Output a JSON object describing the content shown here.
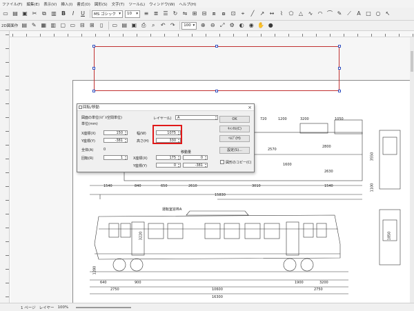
{
  "menu": [
    "ファイル(F)",
    "編集(E)",
    "表示(V)",
    "挿入(I)",
    "書式(O)",
    "図形(S)",
    "文字(T)",
    "ツール(L)",
    "ウィンドウ(W)",
    "ヘルプ(H)"
  ],
  "toolbar1": {
    "font_name": "MS ゴシック",
    "font_size": "10"
  },
  "toolbar2": {
    "label": "2D図面作",
    "zoom": "100"
  },
  "statusbar": {
    "page": "1 ページ",
    "layer": "レイヤー",
    "zoom": "100%"
  },
  "dialog": {
    "title": "回転/移動",
    "unit_header": "図面の単位(ﾓﾃﾞﾙ空間単位)",
    "unit_sub": "単位(mm)",
    "layer_label": "レイヤー(L)",
    "layer_value": "A",
    "width_label": "幅(W)",
    "height_label": "高さ(H)",
    "width_value": "1075",
    "height_value": "330",
    "x_label": "X座標(X)",
    "y_label": "Y座標(Y)",
    "x_value": "150",
    "y_value": "-381",
    "total_label": "全体(A)",
    "total_value": "0",
    "rotate_label": "回転(R)",
    "rotate_value": "1",
    "offset_header": "移動量",
    "ox_label": "X座標(X)",
    "oy_label": "Y座標(Y)",
    "ox_value": "175",
    "oy_value": "0",
    "ox2_value": "0",
    "oy2_value": "-381",
    "checkbox_label": "図形のコピー(C)",
    "buttons": [
      "OK",
      "ｷｬﾝｾﾙ(C)",
      "ﾍﾙﾌﾟ(H)",
      "設定(S)..."
    ]
  },
  "dimensions": {
    "top_row": [
      "720",
      "1200",
      "3200",
      "1050"
    ],
    "mid_row": [
      "2570",
      "2800",
      "1600",
      "2630"
    ],
    "row2": [
      "1540",
      "840",
      "650",
      "2610",
      "3010",
      "1540"
    ],
    "total_top": "15830",
    "bottom_row": [
      "640",
      "900",
      "2750",
      "1900",
      "3200",
      "2750"
    ],
    "bottom_row2": [
      "10600",
      "16300"
    ],
    "vertical": [
      "1280",
      "3550",
      "1100",
      "1850",
      "3220"
    ],
    "annotation": "運転室窓枠A"
  }
}
